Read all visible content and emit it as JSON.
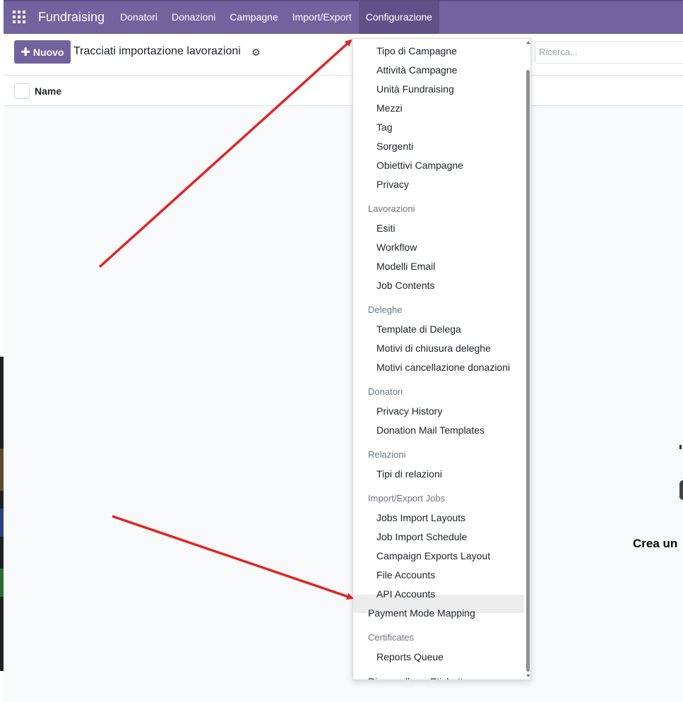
{
  "navbar": {
    "brand": "Fundraising",
    "items": [
      "Donatori",
      "Donazioni",
      "Campagne",
      "Import/Export",
      "Configurazione"
    ],
    "active_item": "Configurazione",
    "color": "#71639e"
  },
  "control": {
    "new_button": "Nuovo",
    "page_title": "Tracciati importazione lavorazioni",
    "search_placeholder": "Ricerca..."
  },
  "list": {
    "columns": [
      "Name"
    ]
  },
  "empty_state": {
    "text": "Crea un"
  },
  "dropdown": {
    "highlighted": "Payment Mode Mapping",
    "entries": [
      {
        "type": "item",
        "label": "Tipo di Campagne"
      },
      {
        "type": "item",
        "label": "Attività Campagne"
      },
      {
        "type": "item",
        "label": "Unità Fundraising"
      },
      {
        "type": "item",
        "label": "Mezzi"
      },
      {
        "type": "item",
        "label": "Tag"
      },
      {
        "type": "item",
        "label": "Sorgenti"
      },
      {
        "type": "item",
        "label": "Obiettivi Campagne"
      },
      {
        "type": "item",
        "label": "Privacy"
      },
      {
        "type": "header",
        "label": "Lavorazioni"
      },
      {
        "type": "item",
        "label": "Esiti"
      },
      {
        "type": "item",
        "label": "Workflow"
      },
      {
        "type": "item",
        "label": "Modelli Email"
      },
      {
        "type": "item",
        "label": "Job Contents"
      },
      {
        "type": "header",
        "label": "Deleghe"
      },
      {
        "type": "item",
        "label": "Template di Delega"
      },
      {
        "type": "item",
        "label": "Motivi di chiusura deleghe"
      },
      {
        "type": "item",
        "label": "Motivi cancellazione donazioni"
      },
      {
        "type": "header",
        "label": "Donatori"
      },
      {
        "type": "item",
        "label": "Privacy History"
      },
      {
        "type": "item",
        "label": "Donation Mail Templates"
      },
      {
        "type": "header",
        "label": "Relazioni"
      },
      {
        "type": "item",
        "label": "Tipi di relazioni"
      },
      {
        "type": "header",
        "label": "Import/Export Jobs"
      },
      {
        "type": "item",
        "label": "Jobs Import Layouts"
      },
      {
        "type": "item",
        "label": "Job Import Schedule"
      },
      {
        "type": "item",
        "label": "Campaign Exports Layout"
      },
      {
        "type": "item",
        "label": "File Accounts"
      },
      {
        "type": "item",
        "label": "API Accounts"
      },
      {
        "type": "root",
        "label": "Payment Mode Mapping"
      },
      {
        "type": "header",
        "label": "Certificates"
      },
      {
        "type": "item",
        "label": "Reports Queue"
      },
      {
        "type": "root",
        "label": "Ripara albero Etichette"
      }
    ]
  },
  "annotation_color": "#e02424"
}
